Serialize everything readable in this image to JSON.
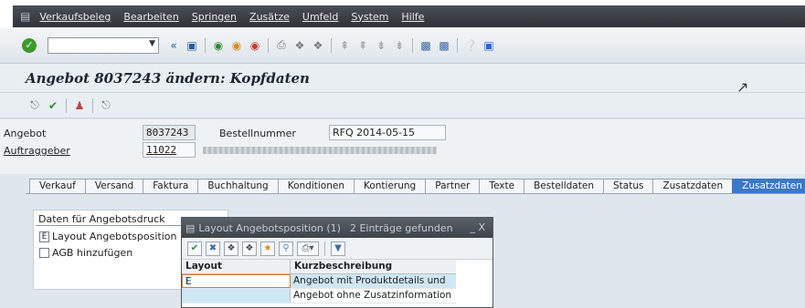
{
  "menubar": {
    "items": [
      "Verkaufsbeleg",
      "Bearbeiten",
      "Springen",
      "Zusätze",
      "Umfeld",
      "System",
      "Hilfe"
    ]
  },
  "toolbar": {
    "command_value": ""
  },
  "title": "Angebot 8037243 ändern: Kopfdaten",
  "header": {
    "angebot_label": "Angebot",
    "angebot_value": "8037243",
    "bestellnummer_label": "Bestellnummer",
    "bestellnummer_value": "RFQ 2014-05-15",
    "auftraggeber_label": "Auftraggeber",
    "auftraggeber_value": "11022"
  },
  "tabs": [
    "Verkauf",
    "Versand",
    "Faktura",
    "Buchhaltung",
    "Konditionen",
    "Kontierung",
    "Partner",
    "Texte",
    "Bestelldaten",
    "Status",
    "Zusatzdaten A",
    "Zusatzdaten B"
  ],
  "active_tab": "Zusatzdaten B",
  "groupbox": {
    "title": "Daten für Angebotsdruck",
    "layout_key": "E",
    "layout_label": "Layout Angebotsposition",
    "agb_label": "AGB hinzufügen"
  },
  "popup": {
    "title": "Layout Angebotsposition (1)",
    "count_text": "2 Einträge gefunden",
    "controls": "_ X",
    "col1": "Layout Angebotspo...",
    "col2": "Kurzbeschreibung",
    "rows": [
      {
        "key": "E",
        "desc": "Angebot mit Produktdetails und Bild"
      },
      {
        "key": "",
        "desc": "Angebot ohne Zusatzinformation"
      }
    ]
  }
}
